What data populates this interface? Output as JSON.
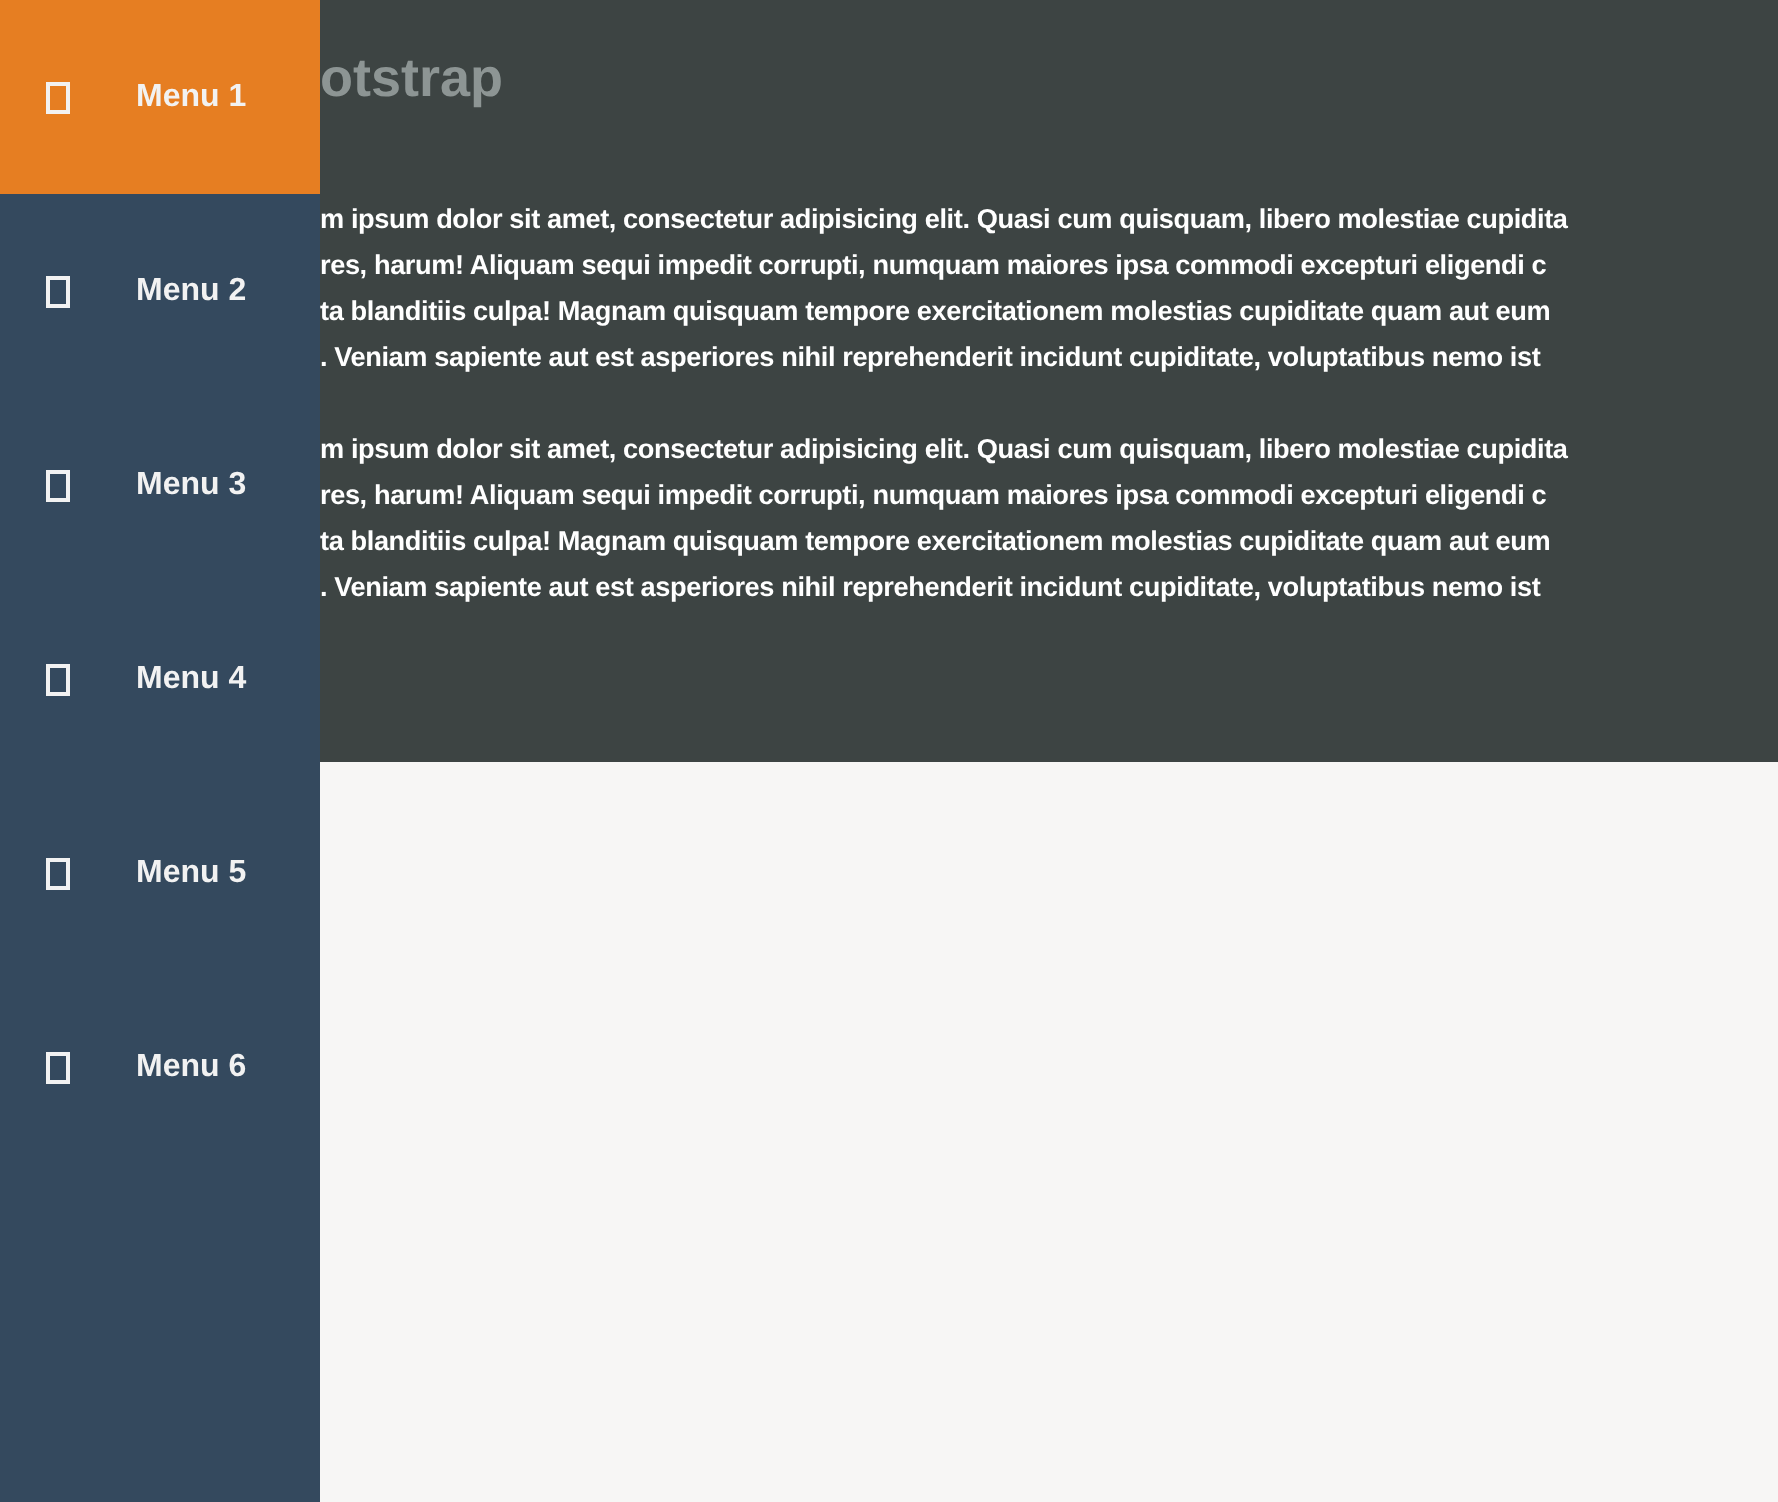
{
  "sidebar": {
    "items": [
      {
        "label": "Menu 1",
        "selected": true
      },
      {
        "label": "Menu 2",
        "selected": false
      },
      {
        "label": "Menu 3",
        "selected": false
      },
      {
        "label": "Menu 4",
        "selected": false
      },
      {
        "label": "Menu 5",
        "selected": false
      },
      {
        "label": "Menu 6",
        "selected": false
      }
    ]
  },
  "header": {
    "title": "otstrap",
    "paragraphs": [
      {
        "lines": [
          "m ipsum dolor sit amet, consectetur adipisicing elit. Quasi cum quisquam, libero molestiae cupidita",
          "res, harum! Aliquam sequi impedit corrupti, numquam maiores ipsa commodi excepturi eligendi c",
          "ta blanditiis culpa! Magnam quisquam tempore exercitationem molestias cupiditate quam aut eum",
          ". Veniam sapiente aut est asperiores nihil reprehenderit incidunt cupiditate, voluptatibus nemo ist"
        ]
      },
      {
        "lines": [
          "m ipsum dolor sit amet, consectetur adipisicing elit. Quasi cum quisquam, libero molestiae cupidita",
          "res, harum! Aliquam sequi impedit corrupti, numquam maiores ipsa commodi excepturi eligendi c",
          "ta blanditiis culpa! Magnam quisquam tempore exercitationem molestias cupiditate quam aut eum",
          ". Veniam sapiente aut est asperiores nihil reprehenderit incidunt cupiditate, voluptatibus nemo ist"
        ]
      }
    ]
  }
}
